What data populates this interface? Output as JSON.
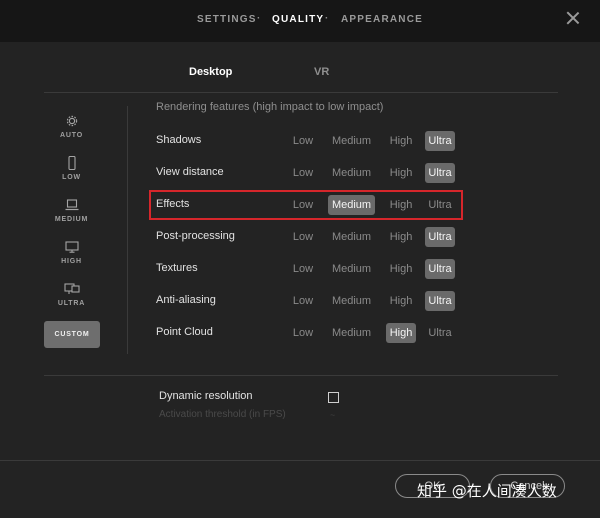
{
  "nav": {
    "items": [
      {
        "label": "SETTINGS"
      },
      {
        "label": "QUALITY"
      },
      {
        "label": "APPEARANCE"
      }
    ],
    "separator": "·"
  },
  "platform_tabs": [
    {
      "label": "Desktop",
      "active": true
    },
    {
      "label": "VR",
      "active": false
    }
  ],
  "presets": [
    {
      "label": "AUTO",
      "icon": "gear-icon"
    },
    {
      "label": "LOW",
      "icon": "phone-icon"
    },
    {
      "label": "MEDIUM",
      "icon": "laptop-icon"
    },
    {
      "label": "HIGH",
      "icon": "monitor-icon"
    },
    {
      "label": "ULTRA",
      "icon": "multi-monitor-icon"
    },
    {
      "label": "CUSTOM",
      "selected": true
    }
  ],
  "rendering": {
    "title": "Rendering features (high impact to low impact)",
    "option_labels": [
      "Low",
      "Medium",
      "High",
      "Ultra"
    ],
    "rows": [
      {
        "label": "Shadows",
        "selected": "Ultra"
      },
      {
        "label": "View distance",
        "selected": "Ultra"
      },
      {
        "label": "Effects",
        "selected": "Medium"
      },
      {
        "label": "Post-processing",
        "selected": "Ultra"
      },
      {
        "label": "Textures",
        "selected": "Ultra"
      },
      {
        "label": "Anti-aliasing",
        "selected": "Ultra"
      },
      {
        "label": "Point Cloud",
        "selected": "High"
      }
    ]
  },
  "dynamic_resolution": {
    "label": "Dynamic resolution",
    "checked": false,
    "threshold_label": "Activation threshold (in FPS)",
    "threshold_value": "~"
  },
  "footer": {
    "ok_label": "OK",
    "cancel_label": "Cancel",
    "watermark": "知乎 @在人间凑人数"
  },
  "colors": {
    "highlight_border": "#d6262b",
    "selected_option": "#6a6a6a"
  }
}
